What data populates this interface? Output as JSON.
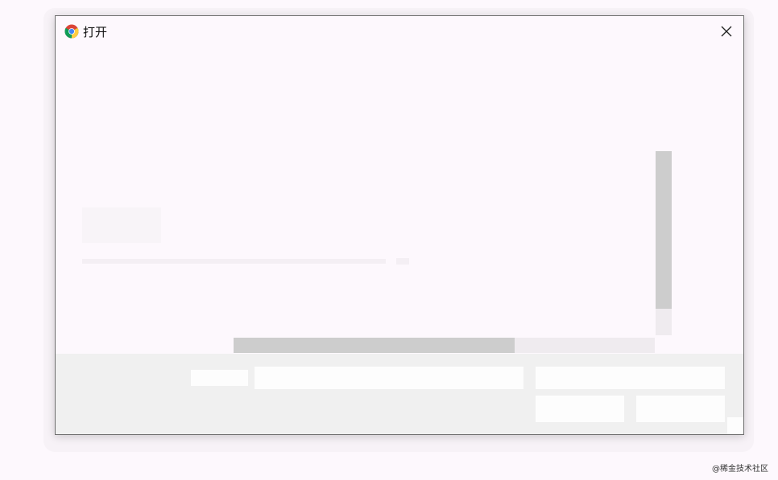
{
  "dialog": {
    "title": "打开",
    "app_icon": "chrome-icon",
    "close_icon": "close-icon"
  },
  "watermark": {
    "text": "@稀金技术社区"
  }
}
